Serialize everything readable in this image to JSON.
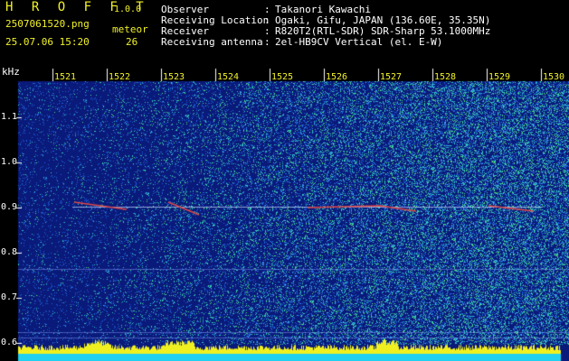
{
  "header": {
    "brand": "H R O F F T",
    "version": "1.0.0",
    "filename": "2507061520.png",
    "datetime": "25.07.06 15:20",
    "event_type": "meteor",
    "event_count": "26",
    "meta": [
      {
        "label": "Observer",
        "sep": ":",
        "value": "Takanori Kawachi"
      },
      {
        "label": "Receiving Location",
        "sep": ":",
        "value": "Ogaki, Gifu, JAPAN (136.60E, 35.35N)"
      },
      {
        "label": "Receiver",
        "sep": ":",
        "value": "R820T2(RTL-SDR) SDR-Sharp 53.1000MHz"
      },
      {
        "label": "Receiving antenna",
        "sep": ":",
        "value": "2el-HB9CV Vertical (el. E-W)"
      }
    ]
  },
  "spectrogram": {
    "y_unit": "kHz",
    "y_ticks": [
      "1.1",
      "1.0",
      "0.9",
      "0.8",
      "0.7",
      "0.6"
    ],
    "x_ticks": [
      "1521",
      "1522",
      "1523",
      "1524",
      "1525",
      "1526",
      "1527",
      "1528",
      "1529",
      "1530"
    ],
    "colors": {
      "background_dark": "#0a1a7a",
      "noise_mid": "#1e60d8",
      "noise_high": "#30c8c0",
      "trace": "#e04848",
      "level_bar": "#f0f020",
      "base_strip": "#20d0f0",
      "label_yellow": "#f2f22a"
    }
  }
}
